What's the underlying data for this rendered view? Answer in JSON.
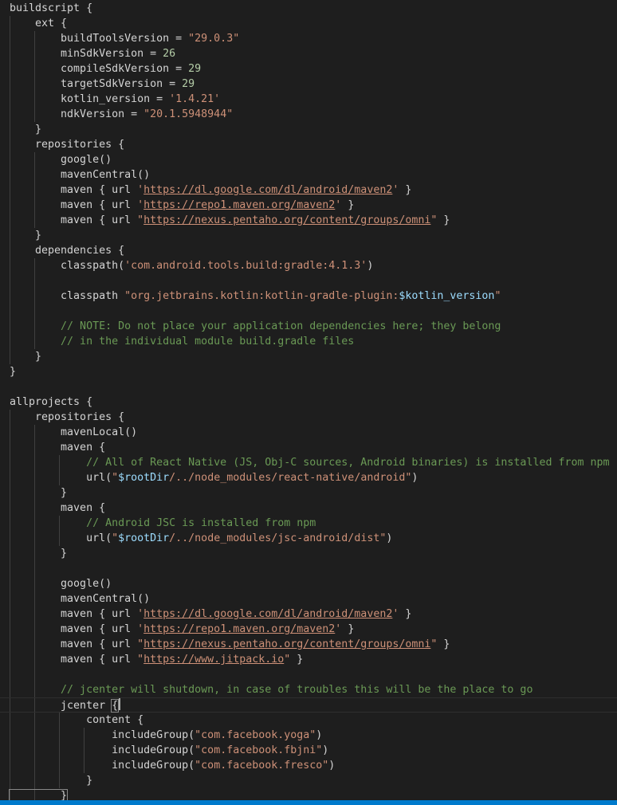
{
  "editor": {
    "language": "groovy",
    "current_line": 46,
    "lines": [
      [
        {
          "t": "buildscript {",
          "c": "plain"
        }
      ],
      [
        {
          "t": "    ext {",
          "c": "plain"
        }
      ],
      [
        {
          "t": "        buildToolsVersion = ",
          "c": "plain"
        },
        {
          "t": "\"29.0.3\"",
          "c": "str"
        }
      ],
      [
        {
          "t": "        minSdkVersion = ",
          "c": "plain"
        },
        {
          "t": "26",
          "c": "num"
        }
      ],
      [
        {
          "t": "        compileSdkVersion = ",
          "c": "plain"
        },
        {
          "t": "29",
          "c": "num"
        }
      ],
      [
        {
          "t": "        targetSdkVersion = ",
          "c": "plain"
        },
        {
          "t": "29",
          "c": "num"
        }
      ],
      [
        {
          "t": "        kotlin_version = ",
          "c": "plain"
        },
        {
          "t": "'1.4.21'",
          "c": "str"
        }
      ],
      [
        {
          "t": "        ndkVersion = ",
          "c": "plain"
        },
        {
          "t": "\"20.1.5948944\"",
          "c": "str"
        }
      ],
      [
        {
          "t": "    }",
          "c": "plain"
        }
      ],
      [
        {
          "t": "    repositories {",
          "c": "plain"
        }
      ],
      [
        {
          "t": "        google()",
          "c": "plain"
        }
      ],
      [
        {
          "t": "        mavenCentral()",
          "c": "plain"
        }
      ],
      [
        {
          "t": "        maven { url ",
          "c": "plain"
        },
        {
          "t": "'",
          "c": "str"
        },
        {
          "t": "https://dl.google.com/dl/android/maven2",
          "c": "url"
        },
        {
          "t": "'",
          "c": "str"
        },
        {
          "t": " }",
          "c": "plain"
        }
      ],
      [
        {
          "t": "        maven { url ",
          "c": "plain"
        },
        {
          "t": "'",
          "c": "str"
        },
        {
          "t": "https://repo1.maven.org/maven2",
          "c": "url"
        },
        {
          "t": "'",
          "c": "str"
        },
        {
          "t": " }",
          "c": "plain"
        }
      ],
      [
        {
          "t": "        maven { url ",
          "c": "plain"
        },
        {
          "t": "\"",
          "c": "str"
        },
        {
          "t": "https://nexus.pentaho.org/content/groups/omni",
          "c": "url"
        },
        {
          "t": "\"",
          "c": "str"
        },
        {
          "t": " }",
          "c": "plain"
        }
      ],
      [
        {
          "t": "    }",
          "c": "plain"
        }
      ],
      [
        {
          "t": "    dependencies {",
          "c": "plain"
        }
      ],
      [
        {
          "t": "        classpath(",
          "c": "plain"
        },
        {
          "t": "'com.android.tools.build:gradle:4.1.3'",
          "c": "str"
        },
        {
          "t": ")",
          "c": "plain"
        }
      ],
      [],
      [
        {
          "t": "        classpath ",
          "c": "plain"
        },
        {
          "t": "\"org.jetbrains.kotlin:kotlin-gradle-plugin:",
          "c": "str"
        },
        {
          "t": "$kotlin_version",
          "c": "var"
        },
        {
          "t": "\"",
          "c": "str"
        }
      ],
      [],
      [
        {
          "t": "        // NOTE: Do not place your application dependencies here; they belong",
          "c": "com"
        }
      ],
      [
        {
          "t": "        // in the individual module build.gradle files",
          "c": "com"
        }
      ],
      [
        {
          "t": "    }",
          "c": "plain"
        }
      ],
      [
        {
          "t": "}",
          "c": "plain"
        }
      ],
      [],
      [
        {
          "t": "allprojects {",
          "c": "plain"
        }
      ],
      [
        {
          "t": "    repositories {",
          "c": "plain"
        }
      ],
      [
        {
          "t": "        mavenLocal()",
          "c": "plain"
        }
      ],
      [
        {
          "t": "        maven {",
          "c": "plain"
        }
      ],
      [
        {
          "t": "            // All of React Native (JS, Obj-C sources, Android binaries) is installed from npm",
          "c": "com"
        }
      ],
      [
        {
          "t": "            url(",
          "c": "plain"
        },
        {
          "t": "\"",
          "c": "str"
        },
        {
          "t": "$rootDir",
          "c": "var"
        },
        {
          "t": "/../node_modules/react-native/android\"",
          "c": "str"
        },
        {
          "t": ")",
          "c": "plain"
        }
      ],
      [
        {
          "t": "        }",
          "c": "plain"
        }
      ],
      [
        {
          "t": "        maven {",
          "c": "plain"
        }
      ],
      [
        {
          "t": "            // Android JSC is installed from npm",
          "c": "com"
        }
      ],
      [
        {
          "t": "            url(",
          "c": "plain"
        },
        {
          "t": "\"",
          "c": "str"
        },
        {
          "t": "$rootDir",
          "c": "var"
        },
        {
          "t": "/../node_modules/jsc-android/dist\"",
          "c": "str"
        },
        {
          "t": ")",
          "c": "plain"
        }
      ],
      [
        {
          "t": "        }",
          "c": "plain"
        }
      ],
      [],
      [
        {
          "t": "        google()",
          "c": "plain"
        }
      ],
      [
        {
          "t": "        mavenCentral()",
          "c": "plain"
        }
      ],
      [
        {
          "t": "        maven { url ",
          "c": "plain"
        },
        {
          "t": "'",
          "c": "str"
        },
        {
          "t": "https://dl.google.com/dl/android/maven2",
          "c": "url"
        },
        {
          "t": "'",
          "c": "str"
        },
        {
          "t": " }",
          "c": "plain"
        }
      ],
      [
        {
          "t": "        maven { url ",
          "c": "plain"
        },
        {
          "t": "'",
          "c": "str"
        },
        {
          "t": "https://repo1.maven.org/maven2",
          "c": "url"
        },
        {
          "t": "'",
          "c": "str"
        },
        {
          "t": " }",
          "c": "plain"
        }
      ],
      [
        {
          "t": "        maven { url ",
          "c": "plain"
        },
        {
          "t": "\"",
          "c": "str"
        },
        {
          "t": "https://nexus.pentaho.org/content/groups/omni",
          "c": "url"
        },
        {
          "t": "\"",
          "c": "str"
        },
        {
          "t": " }",
          "c": "plain"
        }
      ],
      [
        {
          "t": "        maven { url ",
          "c": "plain"
        },
        {
          "t": "\"",
          "c": "str"
        },
        {
          "t": "https://www.jitpack.io",
          "c": "url"
        },
        {
          "t": "\"",
          "c": "str"
        },
        {
          "t": " }",
          "c": "plain"
        }
      ],
      [],
      [
        {
          "t": "        // jcenter will shutdown, in case of troubles this will be the place to go",
          "c": "com"
        }
      ],
      [
        {
          "t": "        jcenter ",
          "c": "plain"
        },
        {
          "t": "{",
          "c": "bracket"
        }
      ],
      [
        {
          "t": "            content {",
          "c": "plain"
        }
      ],
      [
        {
          "t": "                includeGroup(",
          "c": "plain"
        },
        {
          "t": "\"com.facebook.yoga\"",
          "c": "str"
        },
        {
          "t": ")",
          "c": "plain"
        }
      ],
      [
        {
          "t": "                includeGroup(",
          "c": "plain"
        },
        {
          "t": "\"com.facebook.fbjni\"",
          "c": "str"
        },
        {
          "t": ")",
          "c": "plain"
        }
      ],
      [
        {
          "t": "                includeGroup(",
          "c": "plain"
        },
        {
          "t": "\"com.facebook.fresco\"",
          "c": "str"
        },
        {
          "t": ")",
          "c": "plain"
        }
      ],
      [
        {
          "t": "            }",
          "c": "plain"
        }
      ],
      [
        {
          "t": "        }",
          "c": "bracket"
        }
      ]
    ]
  }
}
